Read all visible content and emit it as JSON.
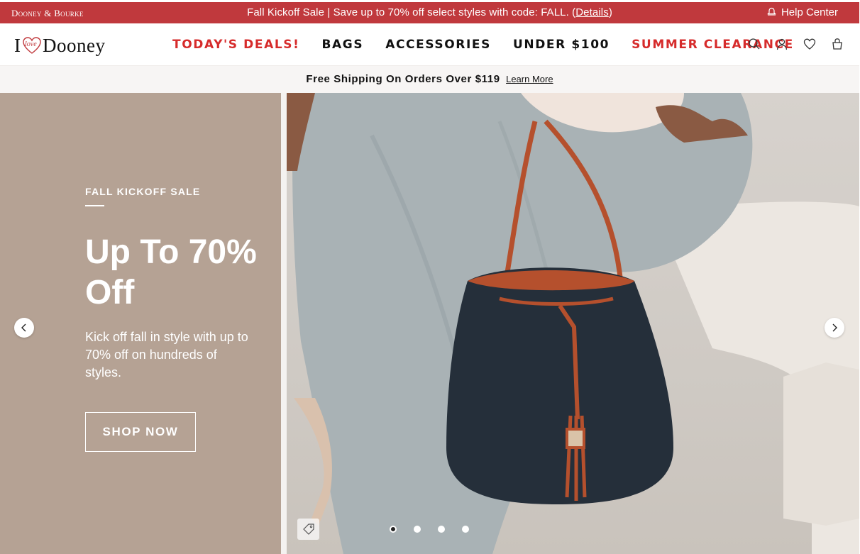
{
  "topbar": {
    "brand": "Dooney & Bourke",
    "promo_text": "Fall Kickoff Sale | Save up to 70% off select styles with code: FALL. (",
    "promo_link": "Details",
    "promo_close": ")",
    "help_label": "Help Center",
    "help_icon": "bell-icon",
    "bg_color": "#c0393d"
  },
  "header": {
    "logo": {
      "i": "I",
      "heart_word": "love",
      "word": "Dooney"
    },
    "nav": [
      {
        "label": "TODAY'S DEALS!",
        "highlight": true
      },
      {
        "label": "BAGS",
        "highlight": false
      },
      {
        "label": "ACCESSORIES",
        "highlight": false
      },
      {
        "label": "UNDER $100",
        "highlight": false
      },
      {
        "label": "SUMMER CLEARANCE",
        "highlight": true
      }
    ],
    "icons": [
      "search-icon",
      "account-icon",
      "wishlist-icon",
      "bag-icon"
    ],
    "accent_color": "#d62b2b"
  },
  "shipbar": {
    "text": "Free Shipping On Orders Over $119",
    "link": "Learn More"
  },
  "hero": {
    "eyebrow": "FALL KICKOFF SALE",
    "headline": "Up To 70% Off",
    "subcopy": "Kick off fall in style with up to 70% off on hundreds of styles.",
    "cta": "SHOP NOW",
    "panel_color": "#b5a294",
    "slides_total": 4,
    "active_slide": 1
  }
}
